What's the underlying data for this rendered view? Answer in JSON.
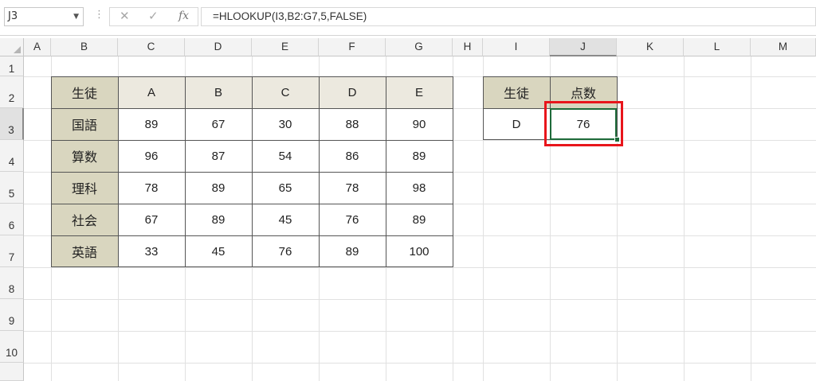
{
  "formula_bar": {
    "name_box": "J3",
    "fx_label": "fx",
    "cancel_glyph": "✕",
    "enter_glyph": "✓",
    "formula": "=HLOOKUP(I3,B2:G7,5,FALSE)"
  },
  "columns": [
    "A",
    "B",
    "C",
    "D",
    "E",
    "F",
    "G",
    "H",
    "I",
    "J",
    "K",
    "L",
    "M"
  ],
  "rows": [
    "1",
    "2",
    "3",
    "4",
    "5",
    "6",
    "7",
    "8",
    "9",
    "10"
  ],
  "table": {
    "header": [
      "生徒",
      "A",
      "B",
      "C",
      "D",
      "E"
    ],
    "rows": [
      {
        "subject": "国語",
        "values": [
          "89",
          "67",
          "30",
          "88",
          "90"
        ]
      },
      {
        "subject": "算数",
        "values": [
          "96",
          "87",
          "54",
          "86",
          "89"
        ]
      },
      {
        "subject": "理科",
        "values": [
          "78",
          "89",
          "65",
          "78",
          "98"
        ]
      },
      {
        "subject": "社会",
        "values": [
          "67",
          "89",
          "45",
          "76",
          "89"
        ]
      },
      {
        "subject": "英語",
        "values": [
          "33",
          "45",
          "76",
          "89",
          "100"
        ]
      }
    ]
  },
  "lookup": {
    "label_student": "生徒",
    "label_score": "点数",
    "student": "D",
    "score": "76"
  },
  "colors": {
    "header_fill": "#ece9df",
    "side_fill": "#d9d6bf",
    "highlight": "#e8151b",
    "active_cell": "#1e6b3a"
  }
}
